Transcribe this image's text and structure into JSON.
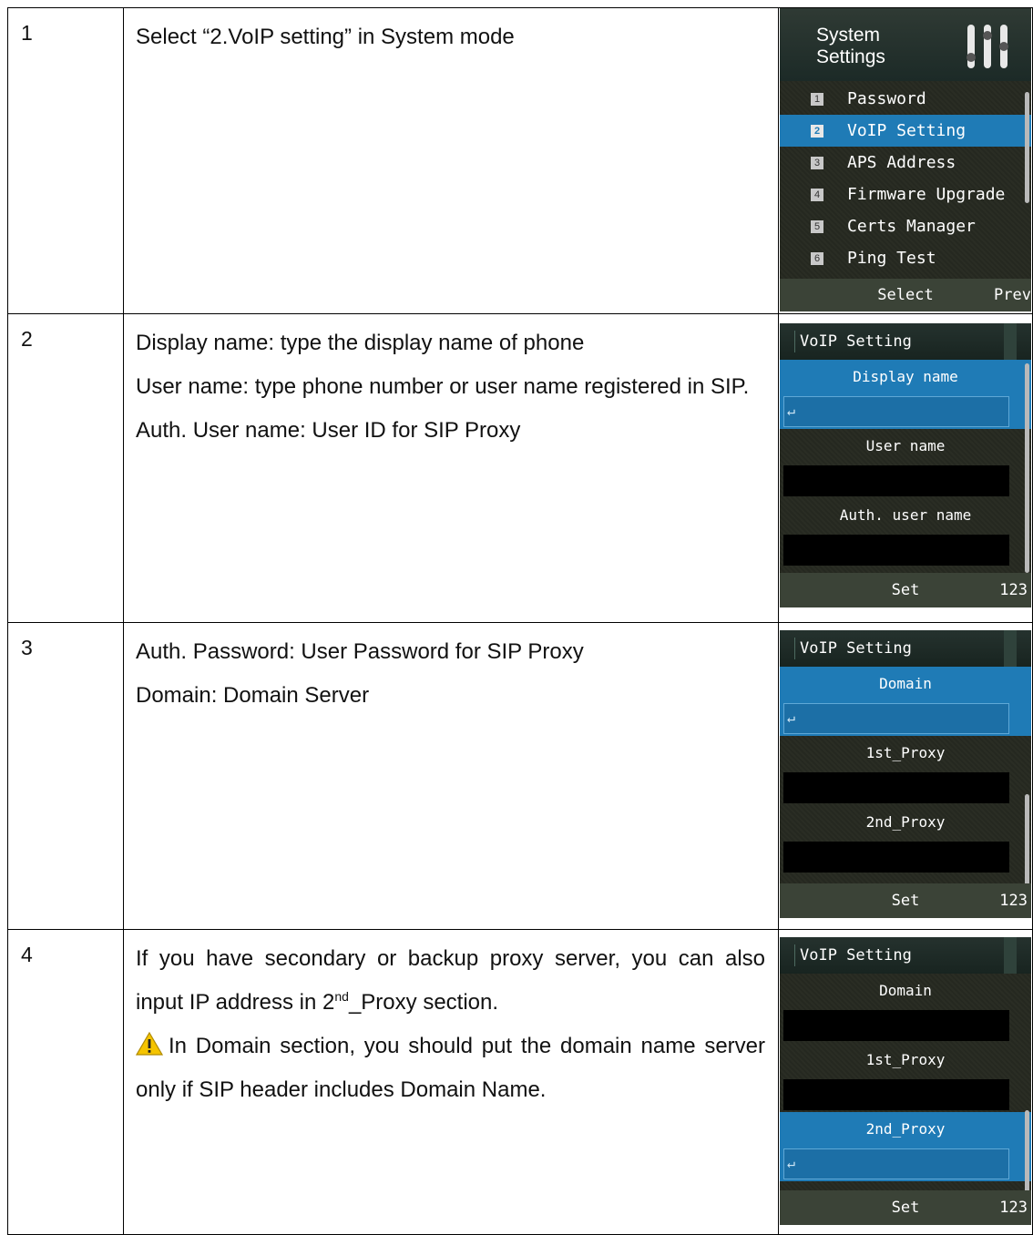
{
  "rows": [
    {
      "num": "1",
      "text": "Select “2.VoIP setting” in System mode",
      "screen": {
        "title_line1": "System",
        "title_line2": "Settings",
        "items": [
          {
            "num": "1",
            "label": "Password"
          },
          {
            "num": "2",
            "label": "VoIP Setting"
          },
          {
            "num": "3",
            "label": "APS Address"
          },
          {
            "num": "4",
            "label": "Firmware Upgrade"
          },
          {
            "num": "5",
            "label": "Certs Manager"
          },
          {
            "num": "6",
            "label": "Ping Test"
          }
        ],
        "selected_item": 2,
        "softkey_center": "Select",
        "softkey_right": "Prev"
      }
    },
    {
      "num": "2",
      "lines": [
        "Display name: type the display name of phone",
        "User name: type phone number or user name registered in SIP.",
        "Auth. User name: User ID for SIP Proxy"
      ],
      "screen": {
        "title": "VoIP Setting",
        "fields": [
          "Display name",
          "User name",
          "Auth. user name"
        ],
        "active_field": 1,
        "softkey_center": "Set",
        "softkey_right": "123"
      }
    },
    {
      "num": "3",
      "lines": [
        "Auth. Password: User Password for SIP Proxy",
        "Domain: Domain Server"
      ],
      "screen": {
        "title": "VoIP Setting",
        "fields": [
          "Domain",
          "1st_Proxy",
          "2nd_Proxy"
        ],
        "active_field": 1,
        "softkey_center": "Set",
        "softkey_right": "123"
      }
    },
    {
      "num": "4",
      "para1_before": "If you have secondary or backup proxy server, you can also input IP address in 2",
      "para1_sup": "nd",
      "para1_after": "_Proxy section.",
      "para2": "In Domain section, you should put the domain name server only if SIP header includes Domain Name.",
      "warning_icon": "warning-triangle-icon",
      "warning_color": "#f5c400",
      "screen": {
        "title": "VoIP Setting",
        "fields": [
          "Domain",
          "1st_Proxy",
          "2nd_Proxy"
        ],
        "active_field": 3,
        "softkey_center": "Set",
        "softkey_right": "123"
      }
    }
  ],
  "colors": {
    "highlight_blue": "#1f7bb6",
    "screen_bg": "#262920",
    "softbar_bg": "#3b4337"
  }
}
